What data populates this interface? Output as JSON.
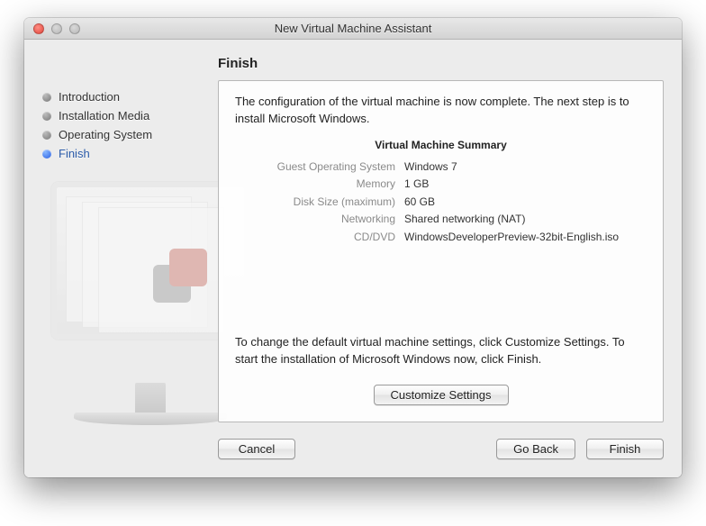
{
  "window": {
    "title": "New Virtual Machine Assistant"
  },
  "sidebar": {
    "steps": [
      {
        "label": "Introduction",
        "active": false
      },
      {
        "label": "Installation Media",
        "active": false
      },
      {
        "label": "Operating System",
        "active": false
      },
      {
        "label": "Finish",
        "active": true
      }
    ]
  },
  "pane": {
    "title": "Finish",
    "intro": "The configuration of the virtual machine is now complete. The next step is to install Microsoft Windows.",
    "summary_heading": "Virtual Machine Summary",
    "rows": [
      {
        "k": "Guest Operating System",
        "v": "Windows 7"
      },
      {
        "k": "Memory",
        "v": "1 GB"
      },
      {
        "k": "Disk Size (maximum)",
        "v": "60 GB"
      },
      {
        "k": "Networking",
        "v": "Shared networking (NAT)"
      },
      {
        "k": "CD/DVD",
        "v": "WindowsDeveloperPreview-32bit-English.iso"
      }
    ],
    "outro": "To change the default virtual machine settings, click Customize Settings. To start the installation of Microsoft Windows now, click Finish.",
    "customize_label": "Customize Settings"
  },
  "footer": {
    "cancel": "Cancel",
    "back": "Go Back",
    "finish": "Finish"
  }
}
